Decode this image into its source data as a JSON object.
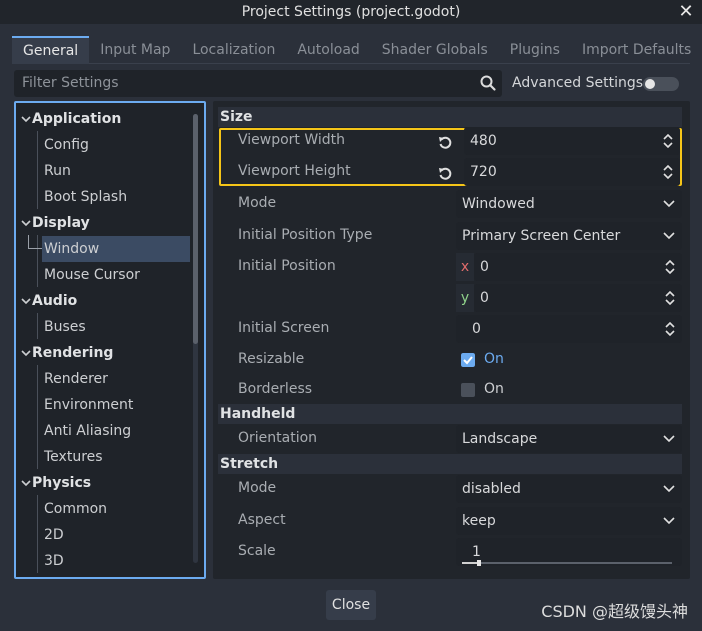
{
  "window": {
    "title": "Project Settings (project.godot)"
  },
  "tabs": [
    {
      "label": "General",
      "active": true
    },
    {
      "label": "Input Map"
    },
    {
      "label": "Localization"
    },
    {
      "label": "Autoload"
    },
    {
      "label": "Shader Globals"
    },
    {
      "label": "Plugins"
    },
    {
      "label": "Import Defaults"
    }
  ],
  "toolbar": {
    "filter_placeholder": "Filter Settings",
    "advanced_label": "Advanced Settings",
    "advanced_enabled": false
  },
  "sidebar": {
    "categories": [
      {
        "label": "Application",
        "items": [
          "Config",
          "Run",
          "Boot Splash"
        ]
      },
      {
        "label": "Display",
        "items": [
          "Window",
          "Mouse Cursor"
        ],
        "selected": "Window"
      },
      {
        "label": "Audio",
        "items": [
          "Buses"
        ]
      },
      {
        "label": "Rendering",
        "items": [
          "Renderer",
          "Environment",
          "Anti Aliasing",
          "Textures"
        ]
      },
      {
        "label": "Physics",
        "items": [
          "Common",
          "2D",
          "3D"
        ]
      }
    ]
  },
  "sections": {
    "size": {
      "title": "Size",
      "viewport_width": {
        "label": "Viewport Width",
        "value": "480"
      },
      "viewport_height": {
        "label": "Viewport Height",
        "value": "720"
      },
      "mode": {
        "label": "Mode",
        "value": "Windowed"
      },
      "initial_position_type": {
        "label": "Initial Position Type",
        "value": "Primary Screen Center"
      },
      "initial_position": {
        "label": "Initial Position",
        "x_label": "x",
        "x": "0",
        "y_label": "y",
        "y": "0"
      },
      "initial_screen": {
        "label": "Initial Screen",
        "value": "0"
      },
      "resizable": {
        "label": "Resizable",
        "checked": true,
        "text": "On"
      },
      "borderless": {
        "label": "Borderless",
        "checked": false,
        "text": "On"
      }
    },
    "handheld": {
      "title": "Handheld",
      "orientation": {
        "label": "Orientation",
        "value": "Landscape"
      }
    },
    "stretch": {
      "title": "Stretch",
      "mode": {
        "label": "Mode",
        "value": "disabled"
      },
      "aspect": {
        "label": "Aspect",
        "value": "keep"
      },
      "scale": {
        "label": "Scale",
        "value": "1",
        "level": 0.08
      }
    }
  },
  "footer": {
    "close_label": "Close"
  },
  "watermark": "CSDN @超级馒头神",
  "colors": {
    "accent": "#6cabf0",
    "highlight": "#f5c518",
    "selection": "#3b4b63",
    "axis_x": "#e06c6c",
    "axis_y": "#8fd18a"
  }
}
